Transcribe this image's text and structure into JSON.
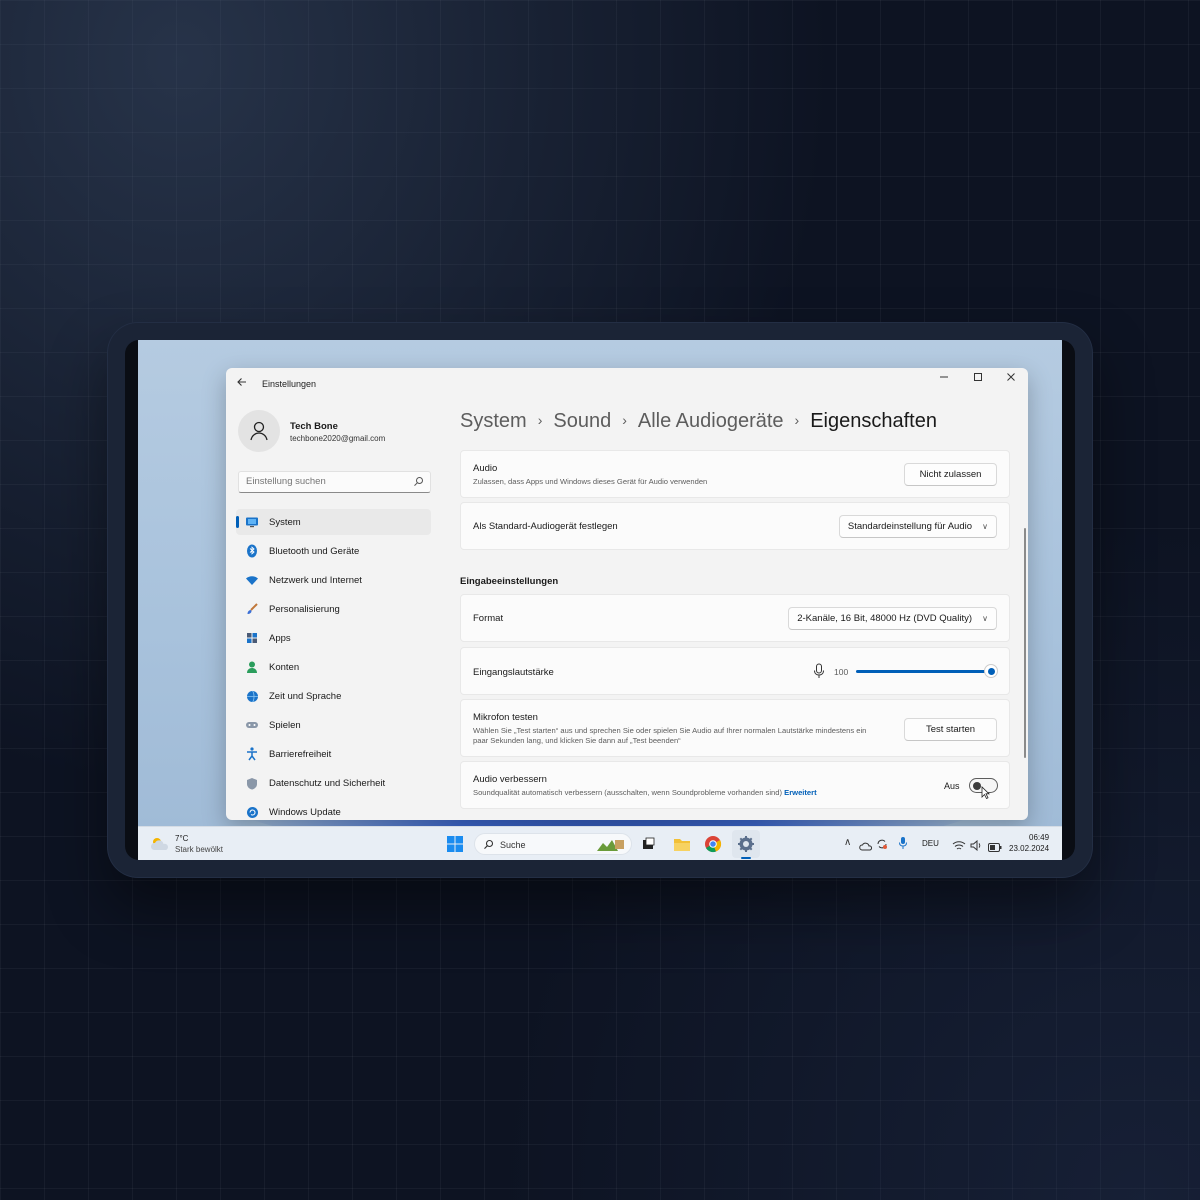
{
  "window": {
    "app_title": "Einstellungen",
    "minimize_icon": "minimize-icon",
    "maximize_icon": "maximize-icon",
    "close_icon": "close-icon"
  },
  "profile": {
    "name": "Tech Bone",
    "email": "techbone2020@gmail.com"
  },
  "search": {
    "placeholder": "Einstellung suchen"
  },
  "sidebar": {
    "items": [
      {
        "label": "System",
        "icon": "monitor-icon",
        "active": true
      },
      {
        "label": "Bluetooth und Geräte",
        "icon": "bluetooth-icon"
      },
      {
        "label": "Netzwerk und Internet",
        "icon": "wifi-icon"
      },
      {
        "label": "Personalisierung",
        "icon": "brush-icon"
      },
      {
        "label": "Apps",
        "icon": "apps-icon"
      },
      {
        "label": "Konten",
        "icon": "person-icon"
      },
      {
        "label": "Zeit und Sprache",
        "icon": "globe-clock-icon"
      },
      {
        "label": "Spielen",
        "icon": "gamepad-icon"
      },
      {
        "label": "Barrierefreiheit",
        "icon": "accessibility-icon"
      },
      {
        "label": "Datenschutz und Sicherheit",
        "icon": "shield-icon"
      },
      {
        "label": "Windows Update",
        "icon": "update-icon"
      }
    ]
  },
  "breadcrumb": [
    "System",
    "Sound",
    "Alle Audiogeräte",
    "Eigenschaften"
  ],
  "content": {
    "audio": {
      "title": "Audio",
      "desc": "Zulassen, dass Apps und Windows dieses Gerät für Audio verwenden",
      "button": "Nicht zulassen"
    },
    "default_device": {
      "title": "Als Standard-Audiogerät festlegen",
      "dropdown": "Standardeinstellung für Audio"
    },
    "section_input": "Eingabeeinstellungen",
    "format": {
      "title": "Format",
      "dropdown": "2-Kanäle, 16 Bit, 48000 Hz (DVD Quality)"
    },
    "input_volume": {
      "title": "Eingangslautstärke",
      "value": "100",
      "level": 1.0
    },
    "mic_test": {
      "title": "Mikrofon testen",
      "desc": "Wählen Sie „Test starten“ aus und sprechen Sie oder spielen Sie Audio auf Ihrer normalen Lautstärke mindestens ein paar Sekunden lang, und klicken Sie dann auf „Test beenden“",
      "button": "Test starten"
    },
    "enhance": {
      "title": "Audio verbessern",
      "desc": "Soundqualität automatisch verbessern (ausschalten, wenn Soundprobleme vorhanden sind)",
      "link": "Erweitert",
      "state": "Aus"
    }
  },
  "taskbar": {
    "weather_temp": "7°C",
    "weather_text": "Stark bewölkt",
    "search": "Suche",
    "lang": "DEU",
    "time": "06:49",
    "date": "23.02.2024"
  },
  "colors": {
    "accent": "#005fb8"
  }
}
